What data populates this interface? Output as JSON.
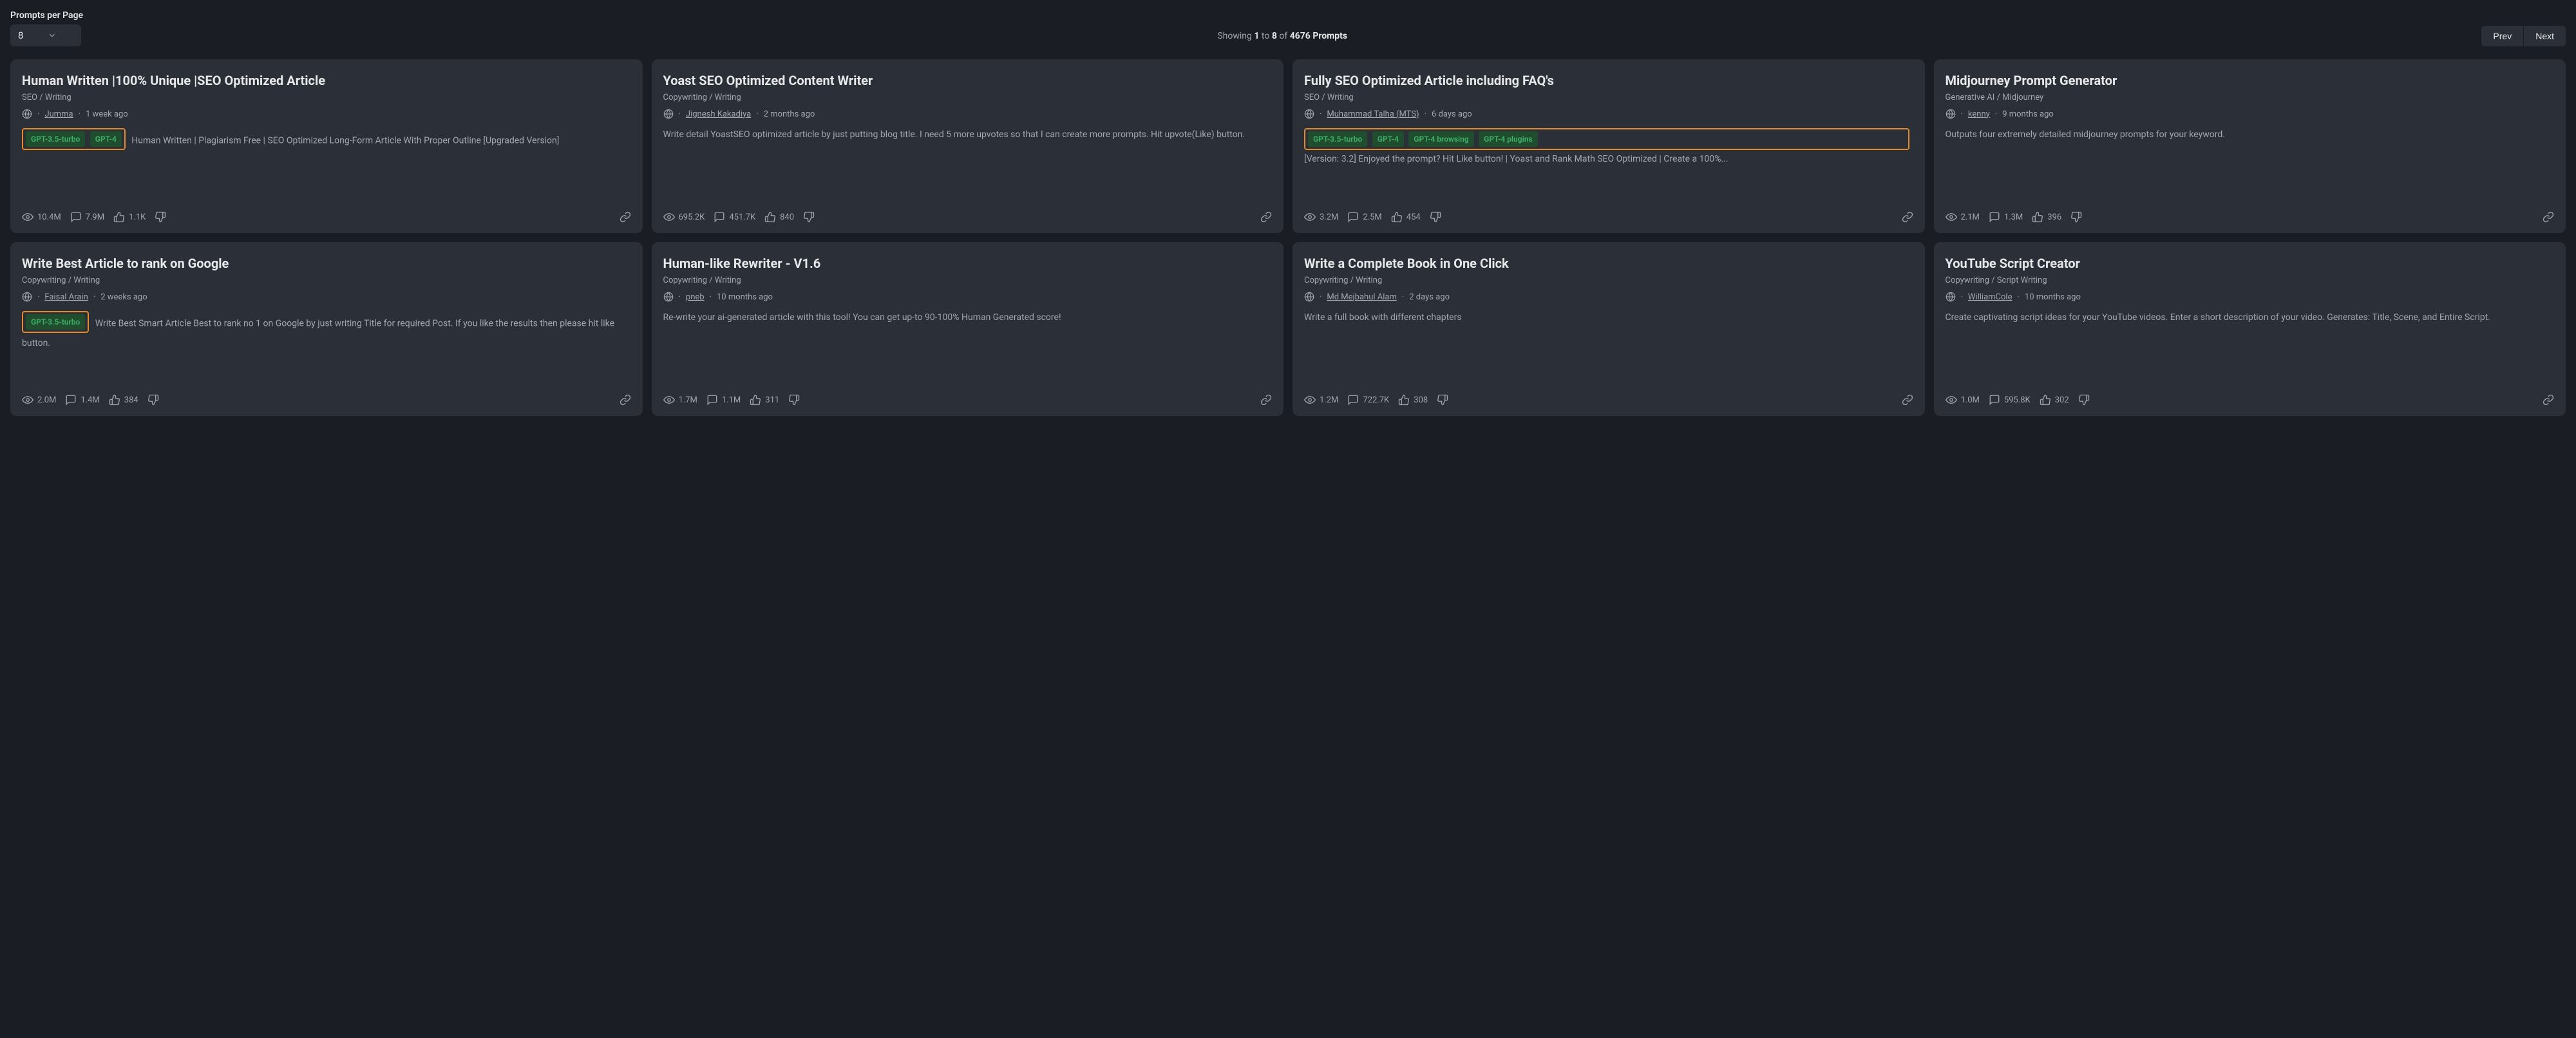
{
  "header": {
    "ppp_label": "Prompts per Page",
    "ppp_value": "8",
    "showing_prefix": "Showing",
    "showing_from": "1",
    "showing_to_word": "to",
    "showing_to": "8",
    "showing_of_word": "of",
    "showing_total": "4676",
    "showing_suffix": "Prompts",
    "prev": "Prev",
    "next": "Next"
  },
  "tags": {
    "gpt35": "GPT-3.5-turbo",
    "gpt4": "GPT-4",
    "gpt4b": "GPT-4 browsing",
    "gpt4p": "GPT-4 plugins"
  },
  "cards": [
    {
      "title": "Human Written |100% Unique |SEO Optimized Article",
      "category": "SEO / Writing",
      "author": "Jumma",
      "time": "1 week ago",
      "desc": "Human Written | Plagiarism Free | SEO Optimized Long-Form Article With Proper Outline [Upgraded Version]",
      "views": "10.4M",
      "comments": "7.9M",
      "likes": "1.1K"
    },
    {
      "title": "Yoast SEO Optimized Content Writer",
      "category": "Copywriting / Writing",
      "author": "Jignesh Kakadiya",
      "time": "2 months ago",
      "desc": "Write detail YoastSEO optimized article by just putting blog title. I need 5 more upvotes so that I can create more prompts. Hit upvote(Like) button.",
      "views": "695.2K",
      "comments": "451.7K",
      "likes": "840"
    },
    {
      "title": "Fully SEO Optimized Article including FAQ's",
      "category": "SEO / Writing",
      "author": "Muhammad Talha (MTS)",
      "time": "6 days ago",
      "desc": "[Version: 3.2] Enjoyed the prompt? Hit Like button! | Yoast and Rank Math SEO Optimized | Create a 100%...",
      "views": "3.2M",
      "comments": "2.5M",
      "likes": "454"
    },
    {
      "title": "Midjourney Prompt Generator",
      "category": "Generative AI / Midjourney",
      "author": "kenny",
      "time": "9 months ago",
      "desc": "Outputs four extremely detailed midjourney prompts for your keyword.",
      "views": "2.1M",
      "comments": "1.3M",
      "likes": "396"
    },
    {
      "title": "Write Best Article to rank on Google",
      "category": "Copywriting / Writing",
      "author": "Faisal Arain",
      "time": "2 weeks ago",
      "desc": "Write Best Smart Article Best to rank no 1 on Google by just writing Title for required Post. If you like the results then please hit like button.",
      "views": "2.0M",
      "comments": "1.4M",
      "likes": "384"
    },
    {
      "title": "Human-like Rewriter - V1.6",
      "category": "Copywriting / Writing",
      "author": "pneb",
      "time": "10 months ago",
      "desc": "Re-write your ai-generated article with this tool! You can get up-to 90-100% Human Generated score!",
      "views": "1.7M",
      "comments": "1.1M",
      "likes": "311"
    },
    {
      "title": "Write a Complete Book in One Click",
      "category": "Copywriting / Writing",
      "author": "Md Mejbahul Alam",
      "time": "2 days ago",
      "desc": "Write a full book with different chapters",
      "views": "1.2M",
      "comments": "722.7K",
      "likes": "308"
    },
    {
      "title": "YouTube Script Creator",
      "category": "Copywriting / Script Writing",
      "author": "WilliamCole",
      "time": "10 months ago",
      "desc": "Create captivating script ideas for your YouTube videos. Enter a short description of your video. Generates: Title, Scene, and Entire Script.",
      "views": "1.0M",
      "comments": "595.8K",
      "likes": "302"
    }
  ]
}
